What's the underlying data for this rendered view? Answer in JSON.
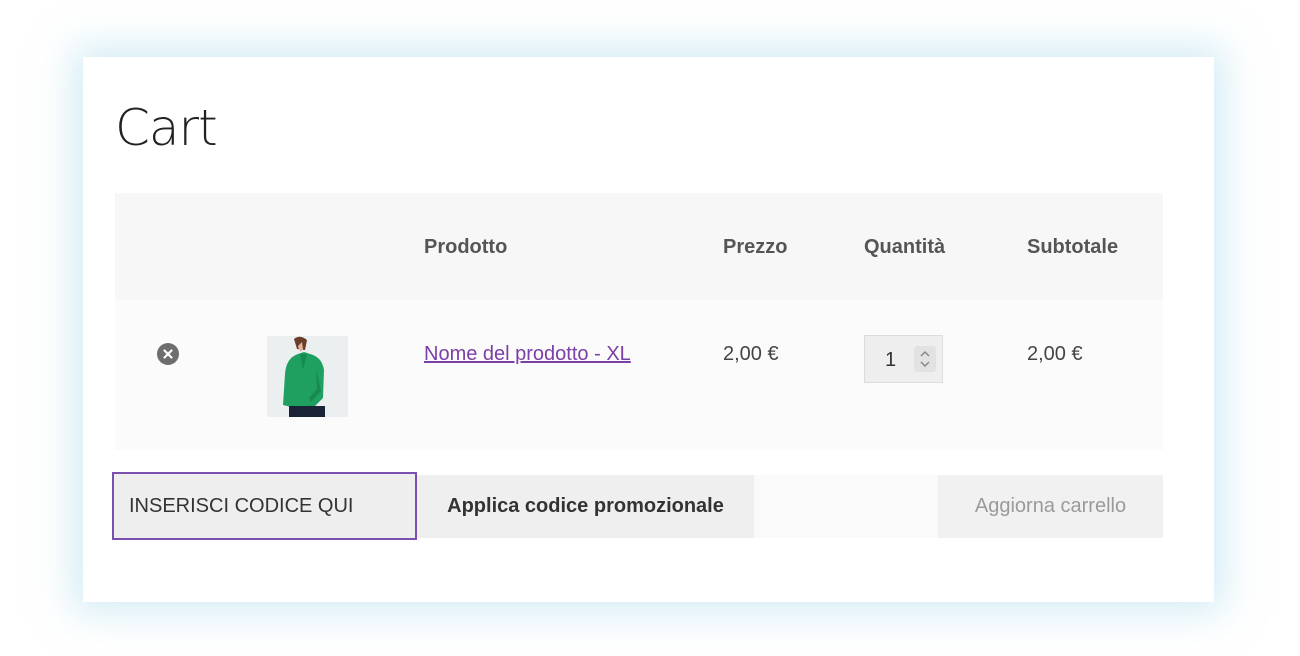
{
  "page": {
    "title": "Cart"
  },
  "table": {
    "headers": {
      "product": "Prodotto",
      "price": "Prezzo",
      "quantity": "Quantità",
      "subtotal": "Subtotale"
    },
    "rows": [
      {
        "product_name": "Nome del prodotto - XL",
        "price": "2,00 €",
        "quantity": "1",
        "subtotal": "2,00 €",
        "remove_icon": "remove-circle-x-icon",
        "thumbnail": "green-blouse-image"
      }
    ]
  },
  "coupon": {
    "value": "INSERISCI CODICE QUI",
    "apply_label": "Applica codice promozionale"
  },
  "actions": {
    "update_label": "Aggiorna carrello"
  },
  "colors": {
    "link": "#7b3fa8",
    "focus_border": "#7b4fb0",
    "header_bg": "#f7f7f7",
    "product_green": "#1fa060"
  }
}
